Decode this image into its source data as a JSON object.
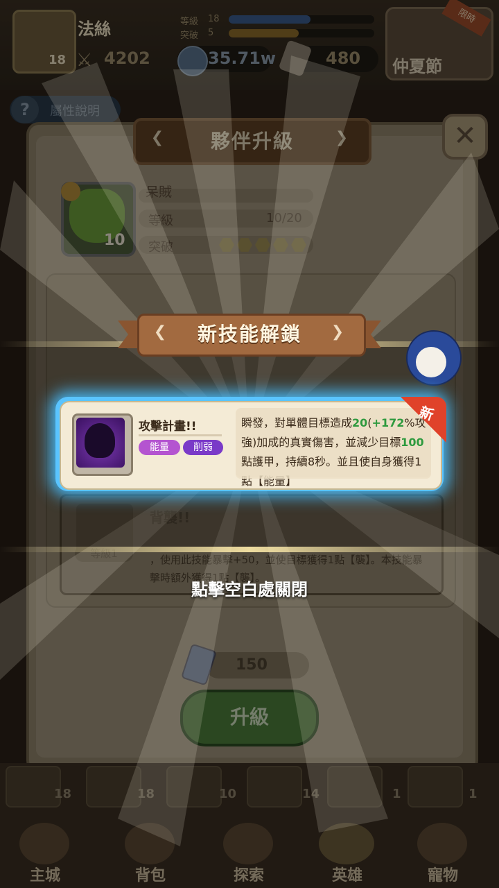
{
  "top_bar": {
    "hero_level": "18",
    "player_name": "法絲",
    "power": "4202",
    "stat_rows": [
      {
        "label": "等級",
        "value": "18",
        "fill_pct": 56,
        "color": "#3a5a8a"
      },
      {
        "label": "突破",
        "value": "5",
        "fill_pct": 48,
        "color": "#8a6a2a"
      }
    ],
    "coins": "35.71w",
    "scrolls": "480",
    "event_label": "仲夏節",
    "event_tag": "限時"
  },
  "help": {
    "label": "屬性說明",
    "icon": "question-icon"
  },
  "panel": {
    "title": "夥伴升級",
    "close_icon": "close-icon",
    "companion": {
      "name": "呆賊",
      "level_badge": "10",
      "level_label": "等級",
      "level_value": "10/20",
      "breakthrough_label": "突破",
      "breakthrough_stars": 5
    },
    "dim_skill": {
      "title": "背襲!!",
      "level_tag": "等級1",
      "description": "，使用此技能暴擊+50，並使目標獲得1點【襲】。本技能暴擊時額外獲得1點【襲】。"
    },
    "cost": "150",
    "upgrade_label": "升級"
  },
  "bottom_nav": {
    "cards": [
      "18",
      "18",
      "10",
      "14",
      "1",
      "1"
    ],
    "items": [
      {
        "label": "主城",
        "icon": "castle-icon"
      },
      {
        "label": "背包",
        "icon": "bag-icon"
      },
      {
        "label": "探索",
        "icon": "map-icon"
      },
      {
        "label": "英雄",
        "icon": "hero-icon"
      },
      {
        "label": "寵物",
        "icon": "pet-icon"
      }
    ]
  },
  "overlay": {
    "banner": "新技能解鎖",
    "skill": {
      "name": "攻擊計畫!!",
      "tags": [
        "能量",
        "削弱"
      ],
      "badge": "新",
      "desc_parts": {
        "p1": "瞬發，對單體目標造成",
        "dmg": "20",
        "open": "(",
        "pct": "+172",
        "p2": "%攻強)加成的真實傷害，並減少目標",
        "armor": "100",
        "p3": "點護甲，持續8秒。並且使自身獲得1點【能量】"
      }
    },
    "close_hint": "點擊空白處關閉"
  }
}
